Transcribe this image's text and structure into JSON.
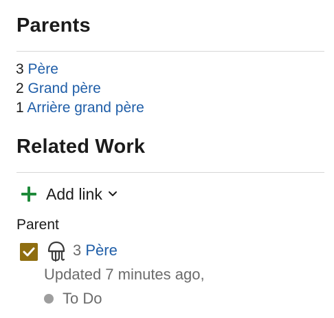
{
  "parents_section": {
    "title": "Parents",
    "items": [
      {
        "level": "3",
        "name": "Père"
      },
      {
        "level": "2",
        "name": "Grand père"
      },
      {
        "level": "1",
        "name": "Arrière grand père"
      }
    ]
  },
  "related_work": {
    "title": "Related Work",
    "add_link_label": "Add link",
    "group_label": "Parent",
    "item": {
      "number": "3",
      "name": "Père",
      "updated": "Updated 7 minutes ago,",
      "status": "To Do",
      "type_icon": "jellyfish-epic-icon",
      "checkbox_icon": "checkmark-icon"
    }
  },
  "colors": {
    "link": "#1f5ea8",
    "add_icon": "#1e8a3a",
    "checkbox": "#8f6e10",
    "status_dot": "#9e9e9e"
  }
}
